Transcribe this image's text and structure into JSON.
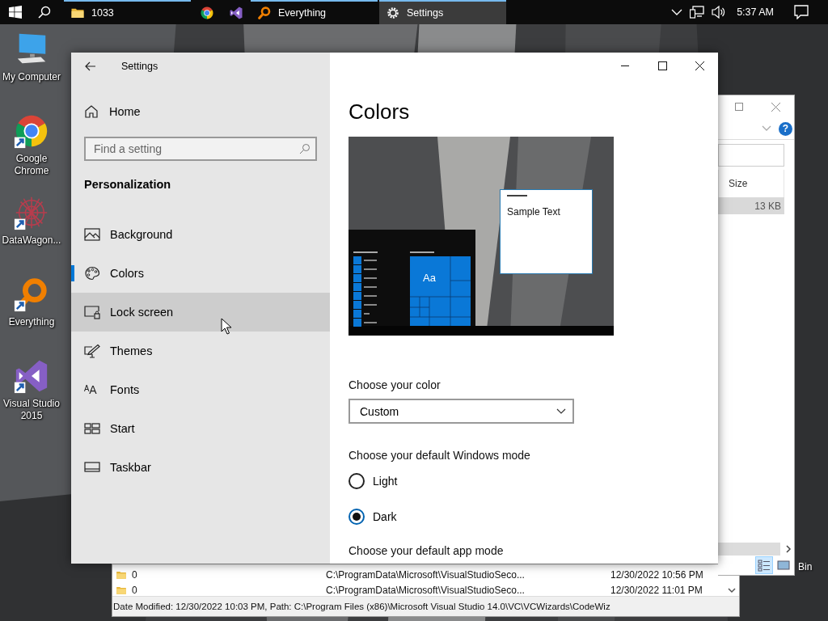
{
  "taskbar": {
    "apps": [
      {
        "kind": "folder",
        "label": "1033",
        "running": true,
        "selected": false
      },
      {
        "kind": "chrome",
        "running": false,
        "selected": false
      },
      {
        "kind": "vs",
        "running": false,
        "selected": false
      },
      {
        "kind": "everything",
        "label": "Everything",
        "running": true,
        "selected": false
      },
      {
        "kind": "settings",
        "label": "Settings",
        "running": true,
        "selected": true
      }
    ],
    "clock": "5:37 AM"
  },
  "desktop_icons": [
    {
      "kind": "computer",
      "label": "My Computer",
      "shortcut": false
    },
    {
      "kind": "chrome",
      "label": "Google Chrome",
      "shortcut": true
    },
    {
      "kind": "datawagon",
      "label": "DataWagon...",
      "shortcut": true
    },
    {
      "kind": "everything",
      "label": "Everything",
      "shortcut": true
    },
    {
      "kind": "vs",
      "label": "Visual Studio 2015",
      "shortcut": true
    }
  ],
  "recycle_bin_label": "Bin",
  "explorer": {
    "help_glyph": "?",
    "column_header": "Size",
    "rows": [
      {
        "size": "13 KB",
        "selected": true
      }
    ]
  },
  "everything": {
    "rows": [
      {
        "name": "0",
        "path": "C:\\ProgramData\\Microsoft\\VisualStudioSeco...",
        "modified": "12/30/2022 10:56 PM"
      },
      {
        "name": "0",
        "path": "C:\\ProgramData\\Microsoft\\VisualStudioSeco...",
        "modified": "12/30/2022 11:01 PM"
      }
    ],
    "status": "Date Modified: 12/30/2022 10:03 PM, Path: C:\\Program Files (x86)\\Microsoft Visual Studio 14.0\\VC\\VCWizards\\CodeWiz"
  },
  "settings": {
    "title": "Settings",
    "home": "Home",
    "search": {
      "placeholder": "Find a setting"
    },
    "section": "Personalization",
    "nav": [
      {
        "kind": "background",
        "label": "Background",
        "selected": false,
        "hovered": false
      },
      {
        "kind": "colors",
        "label": "Colors",
        "selected": true,
        "hovered": false
      },
      {
        "kind": "lockscreen",
        "label": "Lock screen",
        "selected": false,
        "hovered": true
      },
      {
        "kind": "themes",
        "label": "Themes",
        "selected": false,
        "hovered": false
      },
      {
        "kind": "fonts",
        "label": "Fonts",
        "glyph": "ᴬA",
        "selected": false,
        "hovered": false
      },
      {
        "kind": "start",
        "label": "Start",
        "selected": false,
        "hovered": false
      },
      {
        "kind": "taskbar",
        "label": "Taskbar",
        "selected": false,
        "hovered": false
      }
    ],
    "page_title": "Colors",
    "preview": {
      "tile_text": "Aa",
      "sample_text": "Sample Text"
    },
    "color_label": "Choose your color",
    "color_dropdown": {
      "value": "Custom"
    },
    "mode_label": "Choose your default Windows mode",
    "modes": [
      {
        "label": "Light",
        "selected": false
      },
      {
        "label": "Dark",
        "selected": true
      }
    ],
    "app_mode_label": "Choose your default app mode"
  }
}
